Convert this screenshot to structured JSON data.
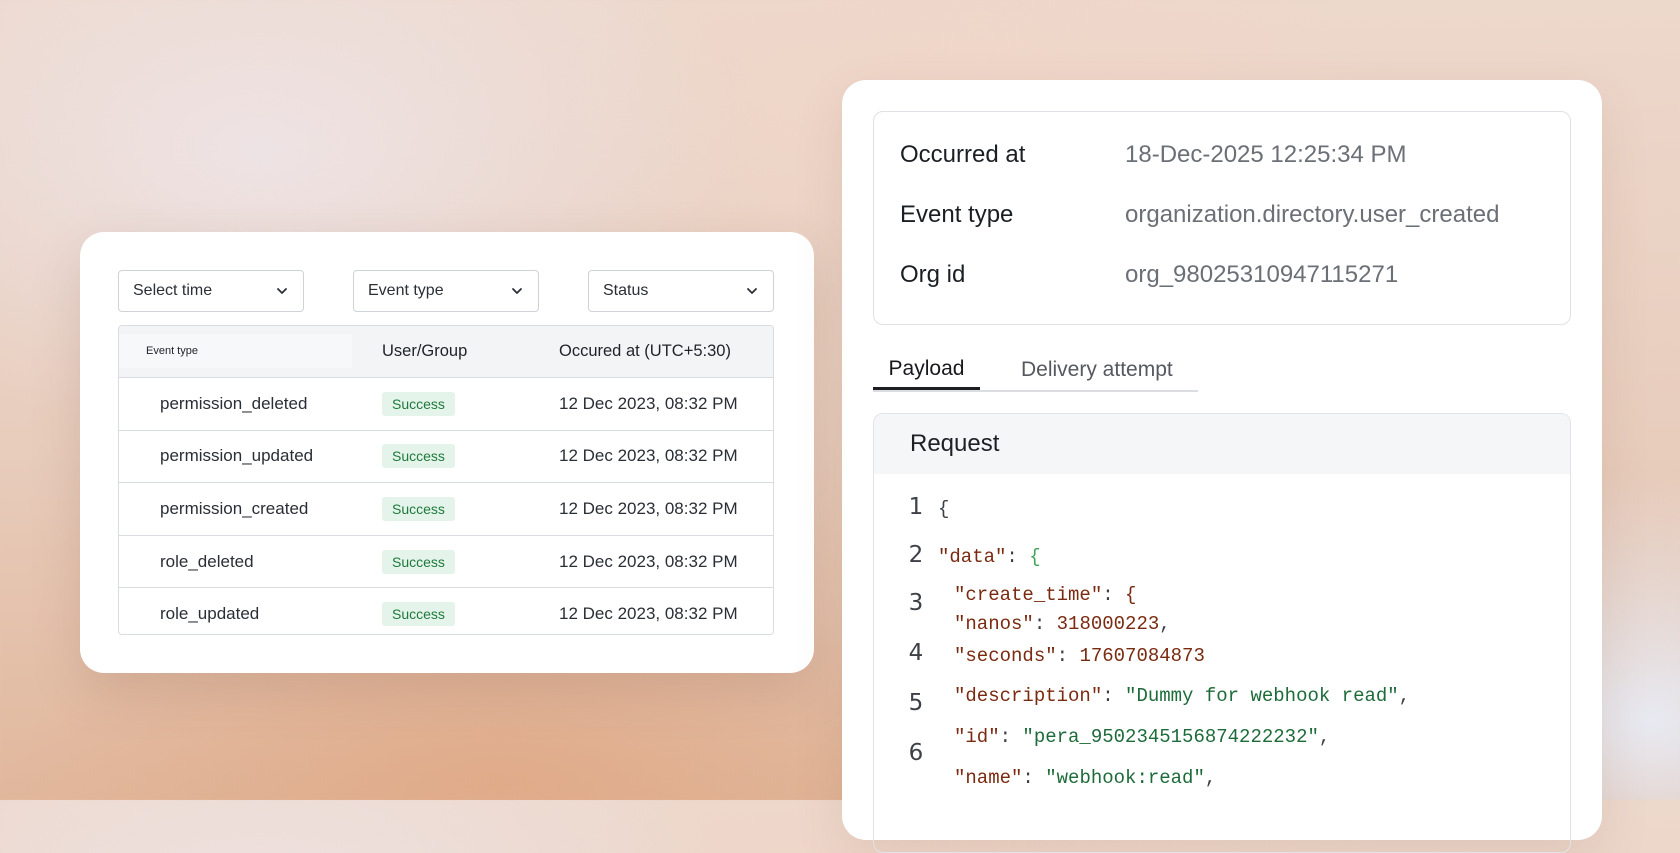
{
  "filters": {
    "time_label": "Select time",
    "event_type_label": "Event type",
    "status_label": "Status"
  },
  "table": {
    "headers": {
      "event_type": "Event type",
      "user_group": "User/Group",
      "occured_at": "Occured at (UTC+5:30)"
    },
    "rows": [
      {
        "event": "permission_deleted",
        "status": "Success",
        "time": "12 Dec 2023, 08:32 PM"
      },
      {
        "event": "permission_updated",
        "status": "Success",
        "time": "12 Dec 2023, 08:32 PM"
      },
      {
        "event": "permission_created",
        "status": "Success",
        "time": "12 Dec 2023, 08:32 PM"
      },
      {
        "event": "role_deleted",
        "status": "Success",
        "time": "12 Dec 2023, 08:32 PM"
      },
      {
        "event": "role_updated",
        "status": "Success",
        "time": "12 Dec 2023, 08:32 PM"
      }
    ]
  },
  "details": {
    "occurred_at_label": "Occurred at",
    "occurred_at_value": "18-Dec-2025 12:25:34 PM",
    "event_type_label": "Event type",
    "event_type_value": "organization.directory.user_created",
    "org_id_label": "Org id",
    "org_id_value": "org_98025310947115271"
  },
  "tabs": {
    "payload": "Payload",
    "delivery": "Delivery attempt"
  },
  "request": {
    "title": "Request",
    "line_numbers": [
      "1",
      "2",
      "3",
      "4",
      "5",
      "6"
    ],
    "code": {
      "l1": "{",
      "data_key": "\"data\"",
      "data_open": "{",
      "create_time_key": "\"create_time\"",
      "create_time_open": "{",
      "nanos_key": "\"nanos\"",
      "nanos_val": "318000223",
      "seconds_key": "\"seconds\"",
      "seconds_val": "17607084873",
      "description_key": "\"description\"",
      "description_val": "\"Dummy for webhook read\"",
      "id_key": "\"id\"",
      "id_val": "\"pera_9502345156874222232\"",
      "name_key": "\"name\"",
      "name_val": "\"webhook:read\""
    }
  },
  "colors": {
    "success_bg": "#e5f4ea",
    "success_text": "#1e7a3c"
  }
}
